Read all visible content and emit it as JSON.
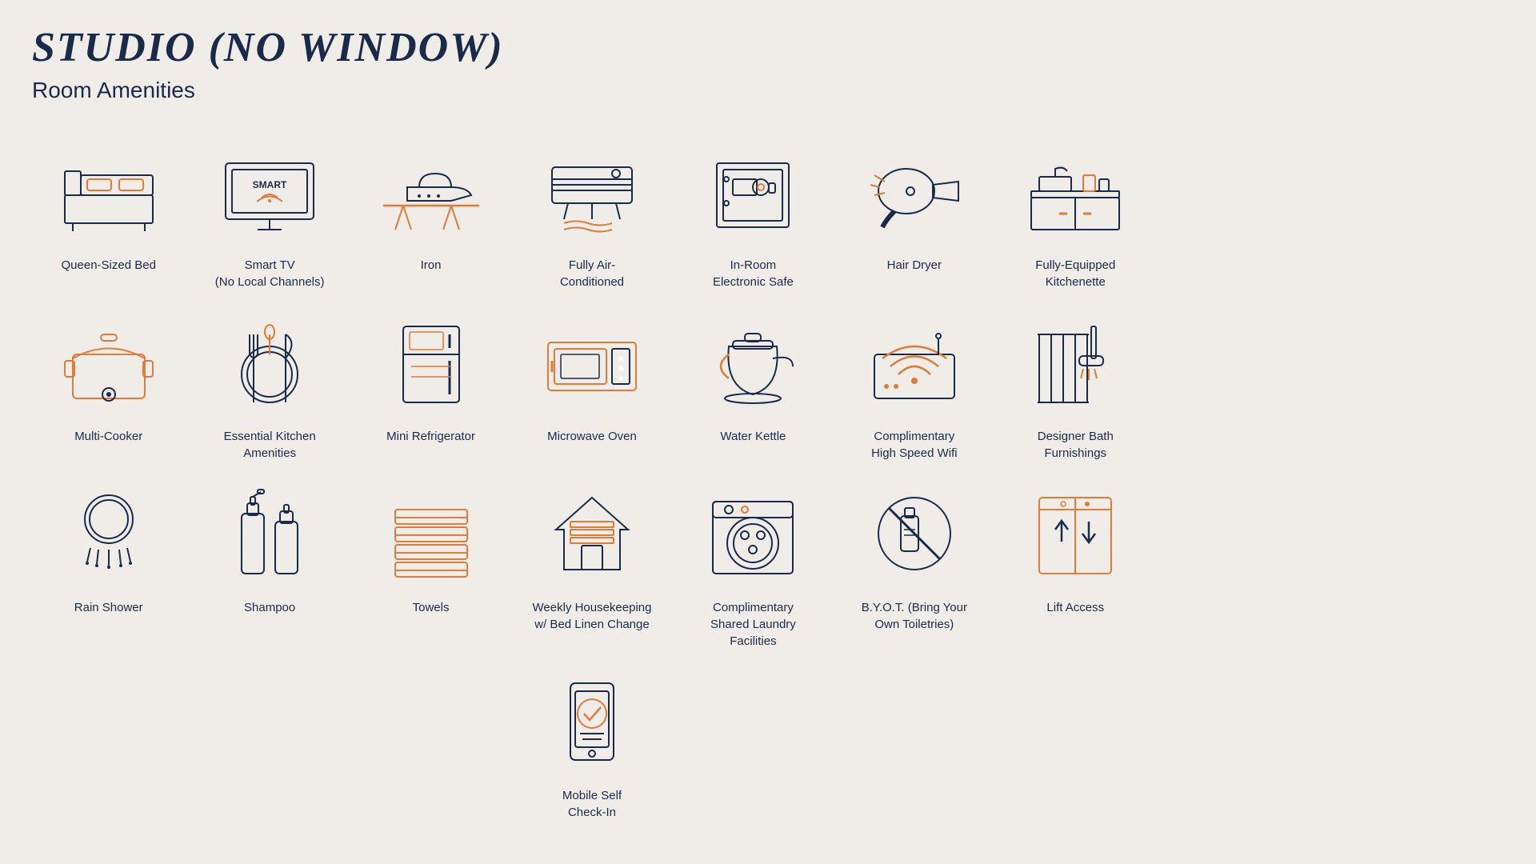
{
  "page": {
    "title": "STUDIO (NO WINDOW)",
    "subtitle": "Room Amenities"
  },
  "amenities": [
    {
      "id": "queen-bed",
      "label": "Queen-Sized Bed"
    },
    {
      "id": "smart-tv",
      "label": "Smart TV\n(No Local Channels)"
    },
    {
      "id": "iron",
      "label": "Iron"
    },
    {
      "id": "air-conditioned",
      "label": "Fully Air-\nConditioned"
    },
    {
      "id": "electronic-safe",
      "label": "In-Room\nElectronic Safe"
    },
    {
      "id": "hair-dryer",
      "label": "Hair Dryer"
    },
    {
      "id": "kitchenette",
      "label": "Fully-Equipped\nKitchenette"
    },
    {
      "id": "multi-cooker",
      "label": "Multi-Cooker"
    },
    {
      "id": "kitchen-amenities",
      "label": "Essential Kitchen\nAmenities"
    },
    {
      "id": "mini-fridge",
      "label": "Mini Refrigerator"
    },
    {
      "id": "microwave",
      "label": "Microwave Oven"
    },
    {
      "id": "water-kettle",
      "label": "Water Kettle"
    },
    {
      "id": "wifi",
      "label": "Complimentary\nHigh Speed Wifi"
    },
    {
      "id": "bath-furnishings",
      "label": "Designer Bath\nFurnishings"
    },
    {
      "id": "rain-shower",
      "label": "Rain Shower"
    },
    {
      "id": "shampoo",
      "label": "Shampoo"
    },
    {
      "id": "towels",
      "label": "Towels"
    },
    {
      "id": "housekeeping",
      "label": "Weekly Housekeeping\nw/ Bed Linen Change"
    },
    {
      "id": "laundry",
      "label": "Complimentary\nShared Laundry\nFacilities"
    },
    {
      "id": "byot",
      "label": "B.Y.O.T. (Bring Your\nOwn Toiletries)"
    },
    {
      "id": "lift",
      "label": "Lift Access"
    },
    {
      "id": "mobile-checkin",
      "label": "Mobile Self\nCheck-In"
    }
  ]
}
